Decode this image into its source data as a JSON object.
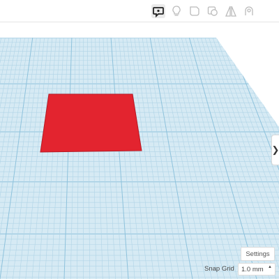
{
  "toolbar": {
    "tools": [
      {
        "icon": "comment-note-icon",
        "active": true
      },
      {
        "icon": "light-bulb-icon",
        "active": false
      },
      {
        "icon": "note-shape-icon",
        "active": false
      },
      {
        "icon": "group-shapes-icon",
        "active": false
      },
      {
        "icon": "mirror-icon",
        "active": false
      },
      {
        "icon": "hole-shape-icon",
        "active": false
      }
    ]
  },
  "workplane": {
    "shape": {
      "name": "box",
      "color": "#e3242f"
    },
    "grid_color_minor": "#b0d4e6",
    "grid_color_major": "#8ec2dc",
    "background": "#d6eaf4"
  },
  "footer": {
    "settings_label": "Settings",
    "snap_grid_label": "Snap Grid",
    "snap_grid_value": "1.0 mm",
    "snap_grid_arrow": "▲"
  },
  "expand_handle": {
    "glyph": "❯"
  }
}
